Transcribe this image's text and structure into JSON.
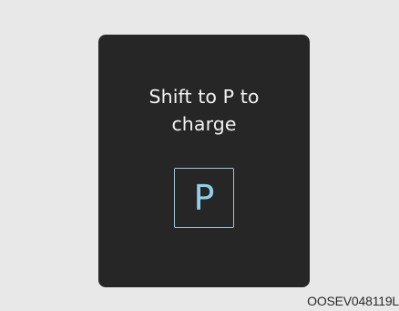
{
  "display": {
    "message_line_1": "Shift to P to",
    "message_line_2": "charge",
    "gear_indicator": "P"
  },
  "figure": {
    "code": "OOSEV048119L"
  },
  "colors": {
    "page_background": "#e8e8e8",
    "panel_background": "#262626",
    "message_text": "#f2f2f2",
    "gear_accent": "#8fd0ea"
  },
  "icons": {
    "gear_indicator": "park-gear-icon"
  }
}
